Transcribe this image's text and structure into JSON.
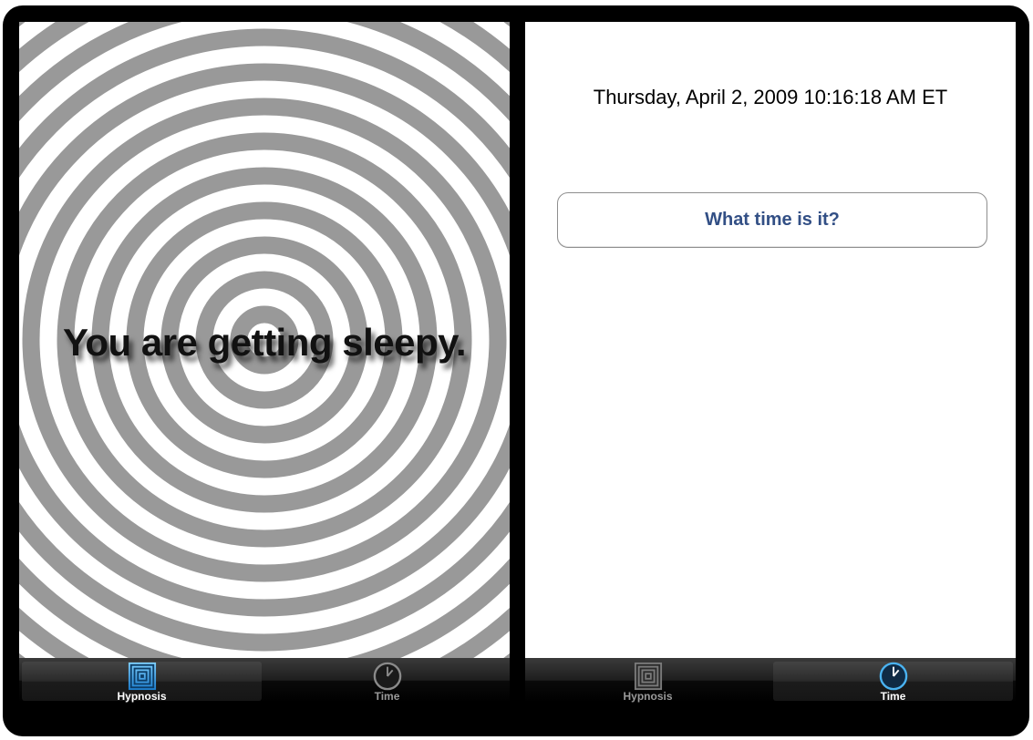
{
  "left_screen": {
    "hypnosis_text": "You are getting sleepy.",
    "tabs": [
      {
        "label": "Hypnosis",
        "icon": "hypnosis-icon",
        "selected": true
      },
      {
        "label": "Time",
        "icon": "clock-icon",
        "selected": false
      }
    ]
  },
  "right_screen": {
    "time_label": "Thursday, April 2, 2009 10:16:18 AM ET",
    "button_label": "What time is it?",
    "tabs": [
      {
        "label": "Hypnosis",
        "icon": "hypnosis-icon",
        "selected": false
      },
      {
        "label": "Time",
        "icon": "clock-icon",
        "selected": true
      }
    ]
  },
  "colors": {
    "ring": "#999999",
    "button_text": "#324f85",
    "selected_icon": "#3aa5e8"
  }
}
